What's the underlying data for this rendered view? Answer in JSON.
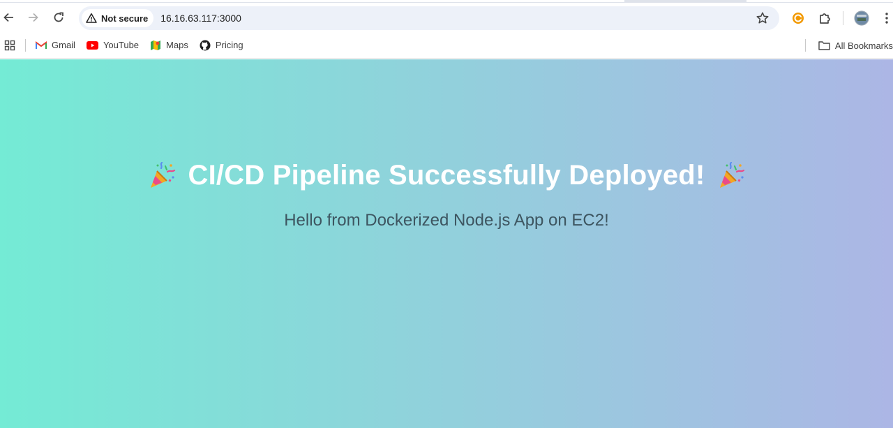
{
  "browser": {
    "security_label": "Not secure",
    "url": "16.16.63.117:3000",
    "bookmarks": [
      {
        "label": "Gmail",
        "icon": "gmail-icon"
      },
      {
        "label": "YouTube",
        "icon": "youtube-icon"
      },
      {
        "label": "Maps",
        "icon": "maps-icon"
      },
      {
        "label": "Pricing",
        "icon": "github-icon"
      }
    ],
    "all_bookmarks_label": "All Bookmarks"
  },
  "page": {
    "title": "CI/CD Pipeline Successfully Deployed!",
    "subtitle": "Hello from Dockerized Node.js App on EC2!",
    "gradient": [
      "#74ebd5",
      "#acb6e5"
    ]
  }
}
